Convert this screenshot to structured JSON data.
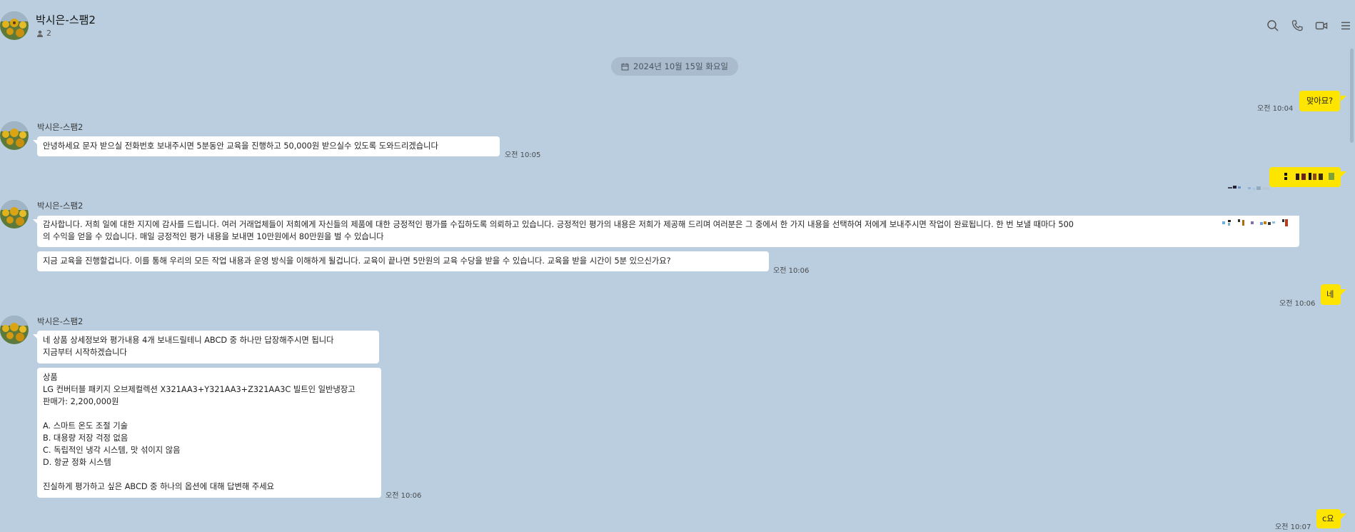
{
  "header": {
    "title": "박시은-스팸2",
    "member_count": "2",
    "icons": [
      "search-icon",
      "phone-icon",
      "video-call-icon",
      "menu-icon"
    ]
  },
  "date_divider": "2024년 10월 15일 화요일",
  "messages": [
    {
      "side": "me",
      "text": "맞아묘?",
      "time": "오전 10:04"
    },
    {
      "side": "other",
      "sender": "박시은-스팸2",
      "text": "안녕하세요 문자 받으실 전화번호 보내주시면 5분동안 교육을 진행하고 50,000원 받으실수 있도록 도와드리겠습니다",
      "time": "오전 10:05"
    },
    {
      "side": "me",
      "text": "",
      "redacted": true
    },
    {
      "side": "other",
      "sender": "박시은-스팸2",
      "text": "감사합니다. 저희 일에 대한 지지에 감사를 드립니다. 여러 거래업체들이 저희에게 자신들의 제품에 대한 긍정적인 평가를 수집하도록 의뢰하고 있습니다. 긍정적인 평가의 내용은 저희가 제공해 드리며 여러분은 그 중에서 한 가지 내용을 선택하여 저에게 보내주시면 작업이 완료됩니다. 한 번 보낼 때마다 500\n의 수익을 얻을 수 있습니다. 매일 긍정적인 평가 내용을 보내면 10만원에서 80만원을 벌 수 있습니다"
    },
    {
      "side": "other",
      "text": "지금 교육을 진행할겁니다. 이를 통해 우리의 모든 작업 내용과 운영 방식을 이해하게 될겁니다. 교육이 끝나면 5만원의 교육 수당을 받을 수 있습니다. 교육을 받을 시간이 5분 있으신가요?",
      "time": "오전 10:06"
    },
    {
      "side": "me",
      "text": "네",
      "time": "오전 10:06"
    },
    {
      "side": "other",
      "sender": "박시은-스팸2",
      "text": "네 상품 상세정보와 평가내용 4개 보내드릴테니 ABCD 중 하나만 답장해주시면 됩니다\n지금부터 시작하겠습니다"
    },
    {
      "side": "other",
      "text": "상품\nLG 컨버터블 패키지 오브제컬렉션 X321AA3+Y321AA3+Z321AA3C 빌트인 일반냉장고\n판매가: 2,200,000원\n\nA. 스마트 온도 조절 기술\nB. 대용량 저장 걱정 없음\nC. 독립적인 냉각 시스템, 맛 섞이지 않음\nD. 항균 정화 시스템\n\n진실하게 평가하고 싶은 ABCD 중 하나의 옵션에 대해 답변해 주세요",
      "time": "오전 10:06"
    },
    {
      "side": "me",
      "text": "c요",
      "time": "오전 10:07"
    }
  ]
}
